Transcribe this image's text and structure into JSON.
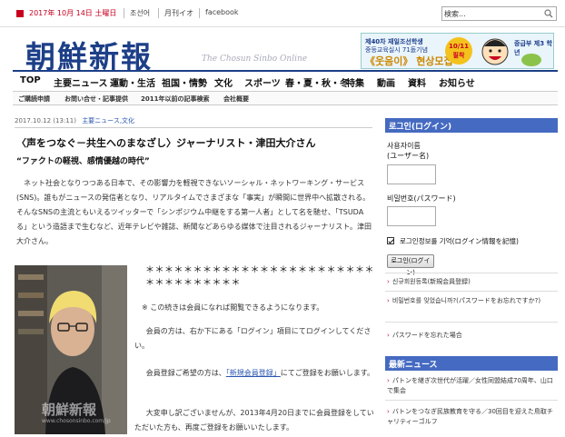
{
  "topbar": {
    "date": "2017年 10月 14日 土曜日",
    "links": [
      "조선어",
      "月刊イオ",
      "facebook"
    ],
    "search_value": "検索..."
  },
  "header": {
    "logo": "朝鮮新報",
    "logo_sub": "The Chosun Sinbo Online",
    "banner": {
      "line1": "제40차 재일조선학생",
      "line2": "중등교육실시 71돐기념",
      "line3": "《웃음이》 현상모집",
      "badge": "10/11 필착",
      "right": "중급부 제3 학년"
    }
  },
  "nav": {
    "items": [
      "TOP",
      "主要ニュース",
      "運動・生活",
      "祖国・情勢",
      "文化",
      "スポーツ",
      "春・夏・秋・冬",
      "特集",
      "動画",
      "資料",
      "お知らせ"
    ]
  },
  "subnav": {
    "items": [
      "ご購読申請",
      "お問い合せ・記事提供",
      "2011年以前の記事検索",
      "会社概要"
    ]
  },
  "article": {
    "date": "2017.10.12 (13:11)",
    "categories": "主要ニュース,文化",
    "title": "〈声をつなぐ－共生へのまなざし〉ジャーナリスト・津田大介さん",
    "subtitle": "“ファクトの軽視、感情優越の時代”",
    "lead": "ネット社会となりつつある日本で、その影響力を軽視できないソーシャル・ネットワーキング・サービス(SNS)。誰もがニュースの発信者となり、リアルタイムでさまざまな「事実」が瞬間に世界中へ拡散される。そんなSNSの主流ともいえるツイッターで「シンポジウム中継をする第一人者」として名を馳せ、「TSUDA る」という造語まで生むなど、近年テレビや雑誌、新聞などあらゆる媒体で注目されるジャーナリスト。津田大介さん。",
    "stars": "＊＊＊＊＊＊＊＊＊＊＊＊＊＊＊＊＊＊＊＊＊＊＊＊＊＊＊＊＊＊＊＊＊＊",
    "notice": "※ この続きは会員になれば閲覧できるようになります。",
    "p1": "会員の方は、右か下にある「ログイン」項目にてログインしてください。",
    "p2_before": "会員登録ご希望の方は、",
    "p2_link": "「新規会員登録」",
    "p2_after": "にてご登録をお願いします。",
    "p3": "大変申し訳ございませんが、2013年4月20日までに会員登録をしていただいた方も、再度ご登録をお願いいたします。",
    "photo_watermark": "朝鮮新報",
    "photo_url": "www.chosonsinbo.com/jp"
  },
  "sidebar": {
    "login_title": "로그인(ログイン)",
    "user_label_1": "사용자이름",
    "user_label_2": "(ユーザー名)",
    "password_label": "비밀번호(パスワード)",
    "remember_label": "로그인정보를 기억(ログイン情報を記憶)",
    "login_button": "로그인(ログイン)",
    "links": [
      "신규회원등록(新規会員登録)",
      "비밀번호를 잊었습니까?(パスワードをお忘れですか?)",
      "パスワードを忘れた場合"
    ],
    "news_title": "最新ニュース",
    "news": [
      "パトンを継ぎ次世代が活躍／女性同盟結成70周年、山口で集会",
      "バトンをつなぎ民族教育を守る／30回目を迎えた鳥取チャリティーゴルフ"
    ]
  },
  "colors": {
    "brand_blue": "#1d3f88",
    "accent_red": "#c8001e",
    "panel_blue": "#456ac1"
  }
}
